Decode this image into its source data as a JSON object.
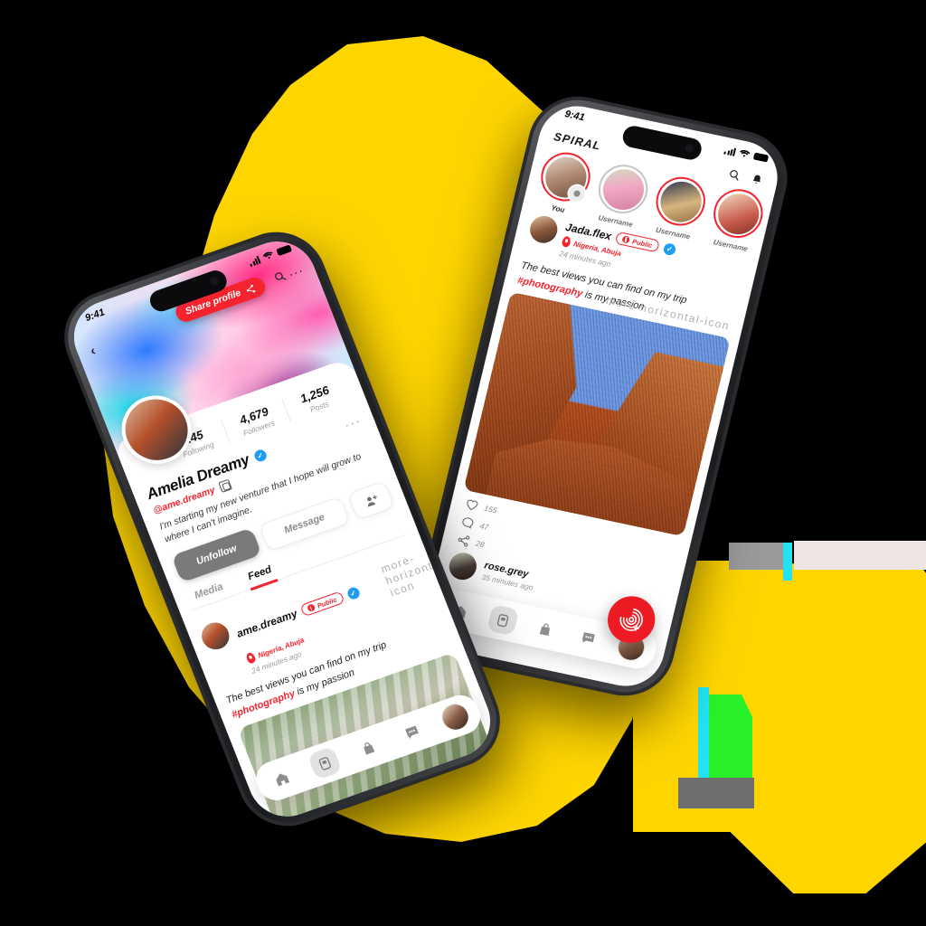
{
  "scene": {
    "background_color": "#000000",
    "accent_yellow": "#FFD500",
    "brand_red": "#F5232E"
  },
  "left_phone": {
    "status_bar": {
      "time": "9:41"
    },
    "cover_header": {
      "back_icon": "chevron-left-icon",
      "share_button_label": "Share profile",
      "share_icon": "share-icon",
      "search_icon": "search-icon",
      "more_icon": "more-horizontal-icon"
    },
    "profile": {
      "name": "Amelia Dreamy",
      "verified": true,
      "handle": "@ame.dreamy",
      "copy_icon": "copy-icon",
      "bio": "I'm starting my new venture that I hope will grow to where I can't imagine.",
      "more_icon": "more-horizontal-icon",
      "stats": [
        {
          "value": "245",
          "label": "Following"
        },
        {
          "value": "4,679",
          "label": "Followers"
        },
        {
          "value": "1,256",
          "label": "Posts"
        }
      ],
      "actions": {
        "primary_label": "Unfollow",
        "secondary_label": "Message",
        "add_friend_icon": "person-add-icon"
      }
    },
    "tabs": [
      {
        "label": "Media",
        "active": false
      },
      {
        "label": "Feed",
        "active": true
      }
    ],
    "post": {
      "username": "ame.dreamy",
      "privacy_badge": "Public",
      "verified": true,
      "location": "Nigeria, Abuja",
      "timestamp": "24 minutes ago",
      "caption_line1": "The best views you can find on my trip",
      "caption_hashtag": "#photography",
      "caption_line2_rest": " is my passion",
      "more_icon": "more-horizontal-icon"
    },
    "navbar": {
      "items": [
        {
          "icon": "home-icon",
          "active": false
        },
        {
          "icon": "feed-card-icon",
          "active": true
        },
        {
          "icon": "shop-bag-icon",
          "active": false
        },
        {
          "icon": "chat-bubble-icon",
          "active": false
        },
        {
          "icon": "profile-avatar",
          "active": false
        }
      ]
    }
  },
  "right_phone": {
    "status_bar": {
      "time": "9:41"
    },
    "header": {
      "brand": "SPIRAL",
      "search_icon": "search-icon",
      "bell_icon": "notification-bell-icon"
    },
    "stories": [
      {
        "label": "You",
        "ring": "unseen",
        "has_badge": true
      },
      {
        "label": "Username",
        "ring": "seen",
        "has_badge": false
      },
      {
        "label": "Username",
        "ring": "unseen",
        "has_badge": false
      },
      {
        "label": "Username",
        "ring": "unseen",
        "has_badge": false
      }
    ],
    "post": {
      "username": "Jada.flex",
      "privacy_badge": "Public",
      "verified": true,
      "location": "Nigeria, Abuja",
      "timestamp": "24 minutes ago",
      "caption_line1": "The best views you can find on my trip",
      "caption_hashtag": "#photography",
      "caption_line2_rest": " is my passion",
      "more_icon": "more-horizontal-icon"
    },
    "engagement": [
      {
        "icon": "heart-icon",
        "count": "155"
      },
      {
        "icon": "comment-icon",
        "count": "47"
      },
      {
        "icon": "share-icon",
        "count": "28"
      }
    ],
    "next_post": {
      "username": "rose.grey",
      "timestamp": "35 minutes ago"
    },
    "fab": {
      "icon": "spiral-create-icon"
    },
    "navbar": {
      "items": [
        {
          "icon": "home-icon",
          "active": false
        },
        {
          "icon": "feed-card-icon",
          "active": true
        },
        {
          "icon": "shop-bag-icon",
          "active": false
        },
        {
          "icon": "chat-bubble-icon",
          "active": false
        },
        {
          "icon": "profile-avatar",
          "active": false
        }
      ]
    },
    "post_more_icon": "more-horizontal-icon"
  }
}
